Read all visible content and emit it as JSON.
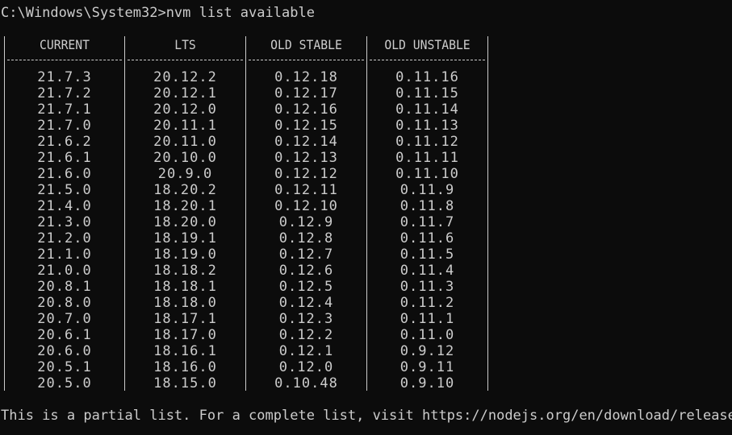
{
  "terminal": {
    "prompt": "C:\\Windows\\System32>nvm list available",
    "footer": "This is a partial list. For a complete list, visit https://nodejs.org/en/download/releases"
  },
  "table": {
    "headers": [
      "CURRENT",
      "LTS",
      "OLD STABLE",
      "OLD UNSTABLE"
    ],
    "columns": [
      [
        "21.7.3",
        "21.7.2",
        "21.7.1",
        "21.7.0",
        "21.6.2",
        "21.6.1",
        "21.6.0",
        "21.5.0",
        "21.4.0",
        "21.3.0",
        "21.2.0",
        "21.1.0",
        "21.0.0",
        "20.8.1",
        "20.8.0",
        "20.7.0",
        "20.6.1",
        "20.6.0",
        "20.5.1",
        "20.5.0"
      ],
      [
        "20.12.2",
        "20.12.1",
        "20.12.0",
        "20.11.1",
        "20.11.0",
        "20.10.0",
        "20.9.0",
        "18.20.2",
        "18.20.1",
        "18.20.0",
        "18.19.1",
        "18.19.0",
        "18.18.2",
        "18.18.1",
        "18.18.0",
        "18.17.1",
        "18.17.0",
        "18.16.1",
        "18.16.0",
        "18.15.0"
      ],
      [
        "0.12.18",
        "0.12.17",
        "0.12.16",
        "0.12.15",
        "0.12.14",
        "0.12.13",
        "0.12.12",
        "0.12.11",
        "0.12.10",
        "0.12.9",
        "0.12.8",
        "0.12.7",
        "0.12.6",
        "0.12.5",
        "0.12.4",
        "0.12.3",
        "0.12.2",
        "0.12.1",
        "0.12.0",
        "0.10.48"
      ],
      [
        "0.11.16",
        "0.11.15",
        "0.11.14",
        "0.11.13",
        "0.11.12",
        "0.11.11",
        "0.11.10",
        "0.11.9",
        "0.11.8",
        "0.11.7",
        "0.11.6",
        "0.11.5",
        "0.11.4",
        "0.11.3",
        "0.11.2",
        "0.11.1",
        "0.11.0",
        "0.9.12",
        "0.9.11",
        "0.9.10"
      ]
    ]
  },
  "colors": {
    "background": "#0c0c0c",
    "foreground": "#cccccc"
  }
}
